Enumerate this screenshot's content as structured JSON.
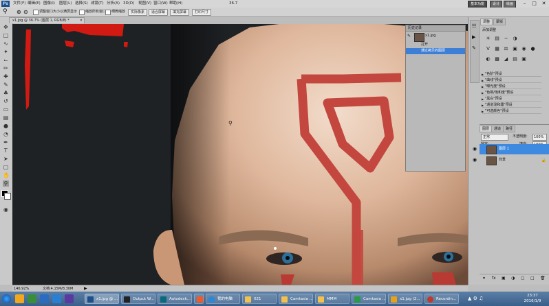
{
  "menubar": {
    "logo": "Ps",
    "items": [
      "文件(F)",
      "编辑(E)",
      "图像(I)",
      "图层(L)",
      "选择(S)",
      "滤镜(T)",
      "分析(A)",
      "3D(D)",
      "视图(V)",
      "窗口(W)",
      "帮助(H)"
    ],
    "zoom": "36.7",
    "workspace_buttons": [
      "基本功能",
      "设计",
      "绘画"
    ],
    "window_controls": [
      "–",
      "□",
      "✕"
    ]
  },
  "options": {
    "chk1": "调整窗口大小以满屏显示",
    "chk2": "缩放所有窗口",
    "chk3": "细微缩放",
    "buttons": [
      "实际像素",
      "适合屏幕",
      "填充屏幕",
      "打印尺寸"
    ]
  },
  "document": {
    "tab": "x1.jpg @ 36.7% (图层 1, RGB/8) *",
    "close": "×"
  },
  "status": {
    "zoom": "146.92%",
    "doc_info": "文档:4.15M/8.30M"
  },
  "history": {
    "title": "历史记录",
    "snapshot": "x1.jpg",
    "items": [
      "打开",
      "通过拷贝的图层"
    ]
  },
  "adjustments": {
    "tabs": [
      "调整",
      "蒙版"
    ],
    "title": "添加调整",
    "presets": [
      "\"色阶\"预设",
      "\"曲线\"预设",
      "\"曝光度\"预设",
      "\"色相/饱和度\"预设",
      "\"黑白\"预设",
      "\"通道混和器\"预设",
      "\"可选颜色\"预设"
    ]
  },
  "layers": {
    "tabs": [
      "图层",
      "通道",
      "路径"
    ],
    "blend_mode": "正常",
    "opacity_label": "不透明度:",
    "opacity": "100%",
    "lock_label": "锁定:",
    "fill_label": "填充:",
    "fill": "100%",
    "items": [
      "图层 1",
      "背景"
    ]
  },
  "taskbar": {
    "tasks": [
      "x1.jpg @ ...",
      "Output W...",
      "Autodesk...",
      "",
      "我的电脑",
      "021",
      "Camtasia ...",
      "MMM",
      "Camtasia ...",
      "x1.jpg (2...",
      "Recordin..."
    ],
    "time": "23:37",
    "date": "2016/1/9"
  },
  "colors": {
    "canvas_bg": "#1f2225",
    "selection": "#3d7fd6",
    "red_paint": "#d01a12",
    "skin": "#e0b89a"
  }
}
